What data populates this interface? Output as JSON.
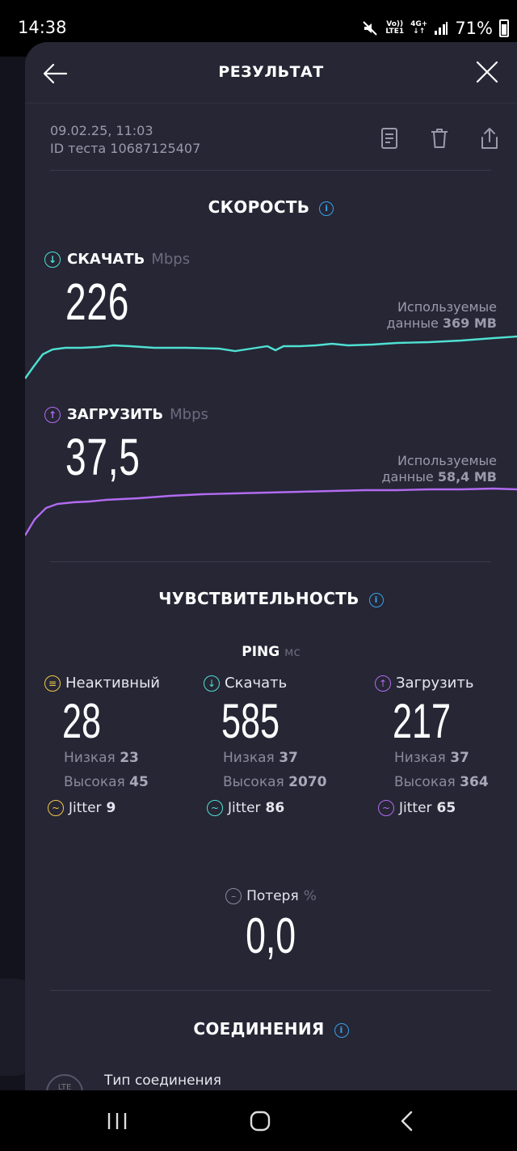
{
  "status_bar": {
    "time": "14:38",
    "net1_top": "Vo))",
    "net1_bottom": "LTE1",
    "net2_top": "4G+",
    "battery": "71%"
  },
  "header": {
    "title": "РЕЗУЛЬТАТ"
  },
  "meta": {
    "date": "09.02.25, 11:03",
    "test_id": "ID теста 10687125407"
  },
  "speed": {
    "title": "СКОРОСТЬ",
    "download": {
      "label": "СКАЧАТЬ",
      "unit": "Mbps",
      "value": "226",
      "used_label": "Используемые",
      "used_prefix": "данные",
      "used_value": "369 MB",
      "color": "#4fe0d2"
    },
    "upload": {
      "label": "ЗАГРУЗИТЬ",
      "unit": "Mbps",
      "value": "37,5",
      "used_label": "Используемые",
      "used_prefix": "данные",
      "used_value": "58,4 MB",
      "color": "#b26bf0"
    }
  },
  "sensitivity": {
    "title": "ЧУВСТВИТЕЛЬНОСТЬ",
    "ping_label": "PING",
    "ping_unit": "мс",
    "idle": {
      "label": "Неактивный",
      "value": "28",
      "low_label": "Низкая",
      "low": "23",
      "high_label": "Высокая",
      "high": "45",
      "jitter_label": "Jitter",
      "jitter": "9",
      "color": "#f0c94a"
    },
    "download": {
      "label": "Скачать",
      "value": "585",
      "low_label": "Низкая",
      "low": "37",
      "high_label": "Высокая",
      "high": "2070",
      "jitter_label": "Jitter",
      "jitter": "86",
      "color": "#4fe0d2"
    },
    "upload": {
      "label": "Загрузить",
      "value": "217",
      "low_label": "Низкая",
      "low": "37",
      "high_label": "Высокая",
      "high": "364",
      "jitter_label": "Jitter",
      "jitter": "65",
      "color": "#b26bf0"
    },
    "loss": {
      "label": "Потеря",
      "unit": "%",
      "value": "0,0"
    }
  },
  "connections": {
    "title": "СОЕДИНЕНИЯ",
    "type_label": "Тип соединения",
    "icon_text": "LTE"
  }
}
